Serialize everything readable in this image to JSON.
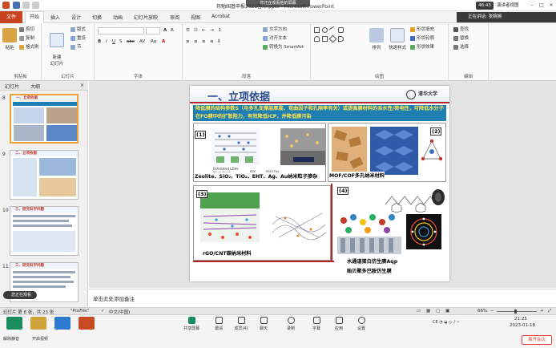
{
  "window": {
    "title": "邦勉国基申报2023答辩.pptx - Microsoft PowerPoint",
    "share_banner": "您正在观看他的屏幕",
    "clock_badge": "46:43",
    "presenter_view": "演讲者视图"
  },
  "ribbon": {
    "tabs": [
      "文件",
      "开始",
      "插入",
      "设计",
      "切换",
      "动画",
      "幻灯片放映",
      "审阅",
      "视图",
      "Acrobat"
    ],
    "speaker": "正在讲话: 张婉婉",
    "groups": {
      "clipboard": {
        "label": "剪贴板",
        "paste": "粘贴",
        "cut": "剪切",
        "copy": "复制",
        "format_painter": "格式刷"
      },
      "slides": {
        "label": "幻灯片",
        "new_slide": "新建\n幻灯片",
        "layout": "版式",
        "reset": "重设",
        "section": "节"
      },
      "font": {
        "label": "字体",
        "font_name": "",
        "font_size": ""
      },
      "paragraph": {
        "label": "段落",
        "text_direction": "文字方向",
        "align_text": "对齐文本",
        "smartart": "转换为 SmartArt"
      },
      "drawing": {
        "label": "绘图",
        "arrange": "排列",
        "quick_styles": "快速样式",
        "fill": "形状填充",
        "outline": "形状轮廓",
        "effects": "形状效果"
      },
      "editing": {
        "label": "编辑",
        "find": "查找",
        "replace": "替换",
        "select": "选择"
      }
    }
  },
  "left_pane": {
    "tabs": [
      "幻灯片",
      "大纲"
    ],
    "thumbnails": [
      {
        "number": "8",
        "title": "一、立项依据"
      },
      {
        "number": "9",
        "title": "二、立项依据"
      },
      {
        "number": "10",
        "title": "三、研究科学问题"
      },
      {
        "number": "11",
        "title": "三、研究科学问题"
      }
    ],
    "notice": "您正在观看"
  },
  "slide": {
    "title": "一、立项依据",
    "logo_text": "清华大学",
    "description": "降低膜的结构参数S（与多孔支撑层厚度、弯曲因子和孔隙率有关）或提高膜材料的亲水性/荷电性，可降低水分子在FO膜中的扩散阻力，有效降低ICP，并降低膜污染",
    "panels": [
      {
        "number": "(1)",
        "caption": "Zeolite、SiO₂、TiO₂、EHT、Ag、Au纳米粒子掺杂",
        "inner_labels": [
          "Exfoliated LDHs\nNanosheet",
          "PSf",
          "PSf/LDH"
        ]
      },
      {
        "number": "(2)",
        "caption": "MOF/COF多孔纳米材料",
        "inner_labels": []
      },
      {
        "number": "(3)",
        "caption": "rGO/CNT碳纳米材料",
        "inner_labels": []
      },
      {
        "number": "(4)",
        "caption": "水通道蛋白仿生膜Aqp\n贻贝聚多巴胺仿生膜",
        "inner_labels": []
      }
    ]
  },
  "notes": {
    "text": "单击此处添加备注"
  },
  "status": {
    "slide_info": "幻灯片 第 8 张，共 23 张",
    "theme": "\"ProFile\"",
    "language": "中文(中国)",
    "zoom": "66%"
  },
  "taskbar": {
    "items_left": [
      {
        "label": "解除静音"
      },
      {
        "label": "开启视频"
      }
    ],
    "meeting_controls": [
      {
        "label": "共享屏幕"
      },
      {
        "label": "邀请"
      },
      {
        "label": "成员(4)"
      },
      {
        "label": "聊天"
      },
      {
        "label": "录制"
      },
      {
        "label": "字幕"
      },
      {
        "label": "应用"
      },
      {
        "label": "设置"
      }
    ],
    "leave_button": "离开会议",
    "time": "21:25",
    "date": "2023-01-18"
  },
  "colors": {
    "file_tab": "#c8431f",
    "slide_title": "#2a4d8f",
    "description_bg": "#1f7fb3",
    "description_text": "#ffe34d",
    "red_accent": "#b3222a"
  }
}
